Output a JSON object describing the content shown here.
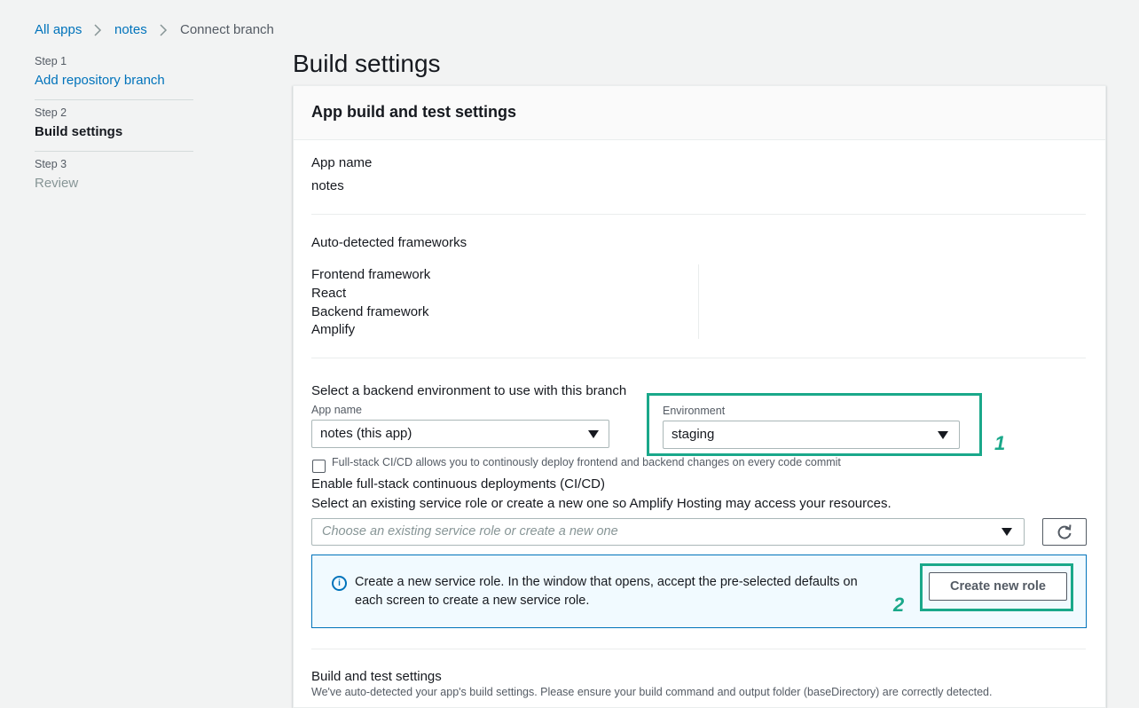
{
  "breadcrumb": {
    "items": [
      "All apps",
      "notes",
      "Connect branch"
    ]
  },
  "steps": [
    {
      "label": "Step 1",
      "title": "Add repository branch"
    },
    {
      "label": "Step 2",
      "title": "Build settings"
    },
    {
      "label": "Step 3",
      "title": "Review"
    }
  ],
  "page": {
    "title": "Build settings"
  },
  "panel": {
    "title": "App build and test settings",
    "app_name_label": "App name",
    "app_name_value": "notes",
    "frameworks_label": "Auto-detected frameworks",
    "frontend_label": "Frontend framework",
    "frontend_value": "React",
    "backend_label": "Backend framework",
    "backend_value": "Amplify",
    "backend_env_label": "Select a backend environment to use with this branch",
    "backend_app_label": "App name",
    "backend_app_value": "notes (this app)",
    "environment_label": "Environment",
    "environment_value": "staging",
    "fullstack_checkbox_desc": "Full-stack CI/CD allows you to continously deploy frontend and backend changes on every code commit",
    "fullstack_checkbox_checked": false,
    "fullstack_checkbox_label": "Enable full-stack continuous deployments (CI/CD)",
    "service_role_label": "Select an existing service role or create a new one so Amplify Hosting may access your resources.",
    "service_role_placeholder": "Choose an existing service role or create a new one",
    "info_text_line1": "Create a new service role. In the window that opens, accept the pre-selected defaults on",
    "info_text_line2": "each screen to create a new service role.",
    "create_role_button": "Create new role",
    "build_test_label": "Build and test settings",
    "build_test_desc": "We've auto-detected your app's build settings. Please ensure your build command and output folder (baseDirectory) are correctly detected."
  },
  "annotations": {
    "marker_1": "1",
    "marker_2": "2"
  },
  "colors": {
    "link": "#0073bb",
    "annotation": "#1aa88a",
    "info_bg": "#f1faff",
    "page_bg": "#f2f3f3"
  },
  "icons": [
    "chevron-right-icon",
    "caret-down-icon",
    "refresh-icon",
    "info-icon"
  ]
}
